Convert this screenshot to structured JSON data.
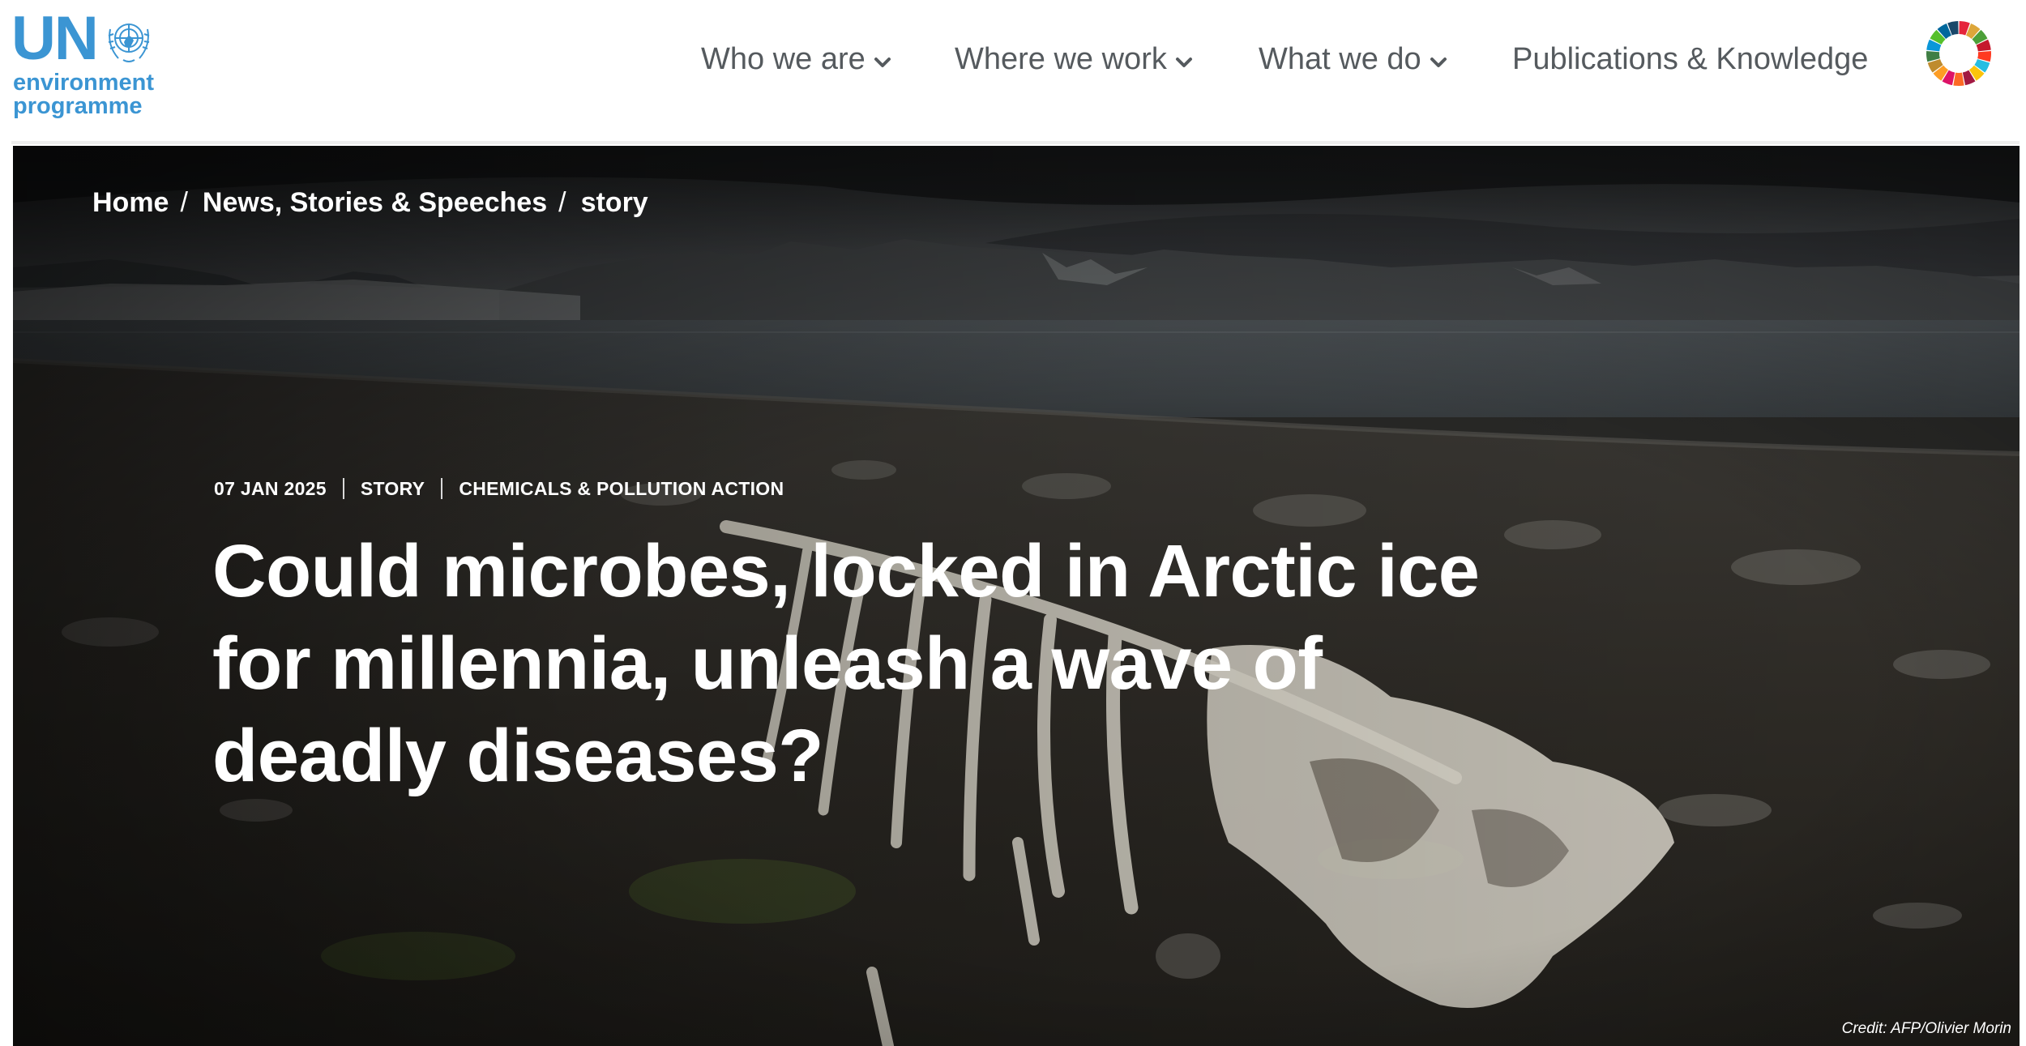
{
  "logo": {
    "wordmark": "UN",
    "line1": "environment",
    "line2": "programme",
    "emblem_icon": "un-emblem-icon",
    "color": "#3b95d3"
  },
  "nav": {
    "items": [
      {
        "label": "Who we are",
        "has_dropdown": true
      },
      {
        "label": "Where we work",
        "has_dropdown": true
      },
      {
        "label": "What we do",
        "has_dropdown": true
      },
      {
        "label": "Publications & Knowledge",
        "has_dropdown": false
      }
    ],
    "sdg_icon": "sdg-wheel-icon"
  },
  "breadcrumb": {
    "items": [
      "Home",
      "News, Stories & Speeches",
      "story"
    ],
    "separator": "/"
  },
  "article": {
    "date": "07 JAN 2025",
    "type": "STORY",
    "topic": "CHEMICALS & POLLUTION ACTION",
    "title": "Could microbes, locked in Arctic ice for millennia, unleash a wave of deadly diseases?",
    "image_credit": "Credit: AFP/Olivier Morin"
  },
  "colors": {
    "brand_blue": "#3b95d3",
    "nav_text": "#555a5e",
    "hero_text": "#ffffff"
  }
}
